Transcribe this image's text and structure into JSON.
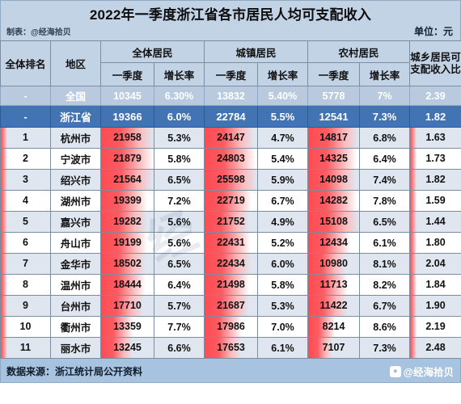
{
  "header": {
    "title": "2022年一季度浙江省各市居民人均可支配收入",
    "credit": "制表：@经海拾贝",
    "unit": "单位：元"
  },
  "columns": {
    "rank": "全体排名",
    "region": "地区",
    "group_all": "全体居民",
    "group_urban": "城镇居民",
    "group_rural": "农村居民",
    "ratio": "城乡居民可支配收入比",
    "sub_quarter": "一季度",
    "sub_growth": "增长率"
  },
  "summary_rows": [
    {
      "rank": "-",
      "region": "全国",
      "all_q": "10345",
      "all_g": "6.30%",
      "urban_q": "13832",
      "urban_g": "5.40%",
      "rural_q": "5778",
      "rural_g": "7%",
      "ratio": "2.39"
    },
    {
      "rank": "-",
      "region": "浙江省",
      "all_q": "19366",
      "all_g": "6.0%",
      "urban_q": "22784",
      "urban_g": "5.5%",
      "rural_q": "12541",
      "rural_g": "7.3%",
      "ratio": "1.82"
    }
  ],
  "rows": [
    {
      "rank": "1",
      "region": "杭州市",
      "all_q": "21958",
      "all_g": "5.3%",
      "urban_q": "24147",
      "urban_g": "4.7%",
      "rural_q": "14817",
      "rural_g": "6.8%",
      "ratio": "1.63"
    },
    {
      "rank": "2",
      "region": "宁波市",
      "all_q": "21879",
      "all_g": "5.8%",
      "urban_q": "24803",
      "urban_g": "5.4%",
      "rural_q": "14325",
      "rural_g": "6.4%",
      "ratio": "1.73"
    },
    {
      "rank": "3",
      "region": "绍兴市",
      "all_q": "21564",
      "all_g": "6.5%",
      "urban_q": "25598",
      "urban_g": "5.9%",
      "rural_q": "14098",
      "rural_g": "7.4%",
      "ratio": "1.82"
    },
    {
      "rank": "4",
      "region": "湖州市",
      "all_q": "19399",
      "all_g": "7.2%",
      "urban_q": "22719",
      "urban_g": "6.7%",
      "rural_q": "14282",
      "rural_g": "7.8%",
      "ratio": "1.59"
    },
    {
      "rank": "5",
      "region": "嘉兴市",
      "all_q": "19282",
      "all_g": "5.6%",
      "urban_q": "21752",
      "urban_g": "4.9%",
      "rural_q": "15108",
      "rural_g": "6.5%",
      "ratio": "1.44"
    },
    {
      "rank": "6",
      "region": "舟山市",
      "all_q": "19199",
      "all_g": "5.6%",
      "urban_q": "22431",
      "urban_g": "5.2%",
      "rural_q": "12434",
      "rural_g": "6.1%",
      "ratio": "1.80"
    },
    {
      "rank": "7",
      "region": "金华市",
      "all_q": "18502",
      "all_g": "6.5%",
      "urban_q": "22434",
      "urban_g": "6.0%",
      "rural_q": "10980",
      "rural_g": "8.1%",
      "ratio": "2.04"
    },
    {
      "rank": "8",
      "region": "温州市",
      "all_q": "18444",
      "all_g": "6.4%",
      "urban_q": "21498",
      "urban_g": "5.8%",
      "rural_q": "11713",
      "rural_g": "8.2%",
      "ratio": "1.84"
    },
    {
      "rank": "9",
      "region": "台州市",
      "all_q": "17710",
      "all_g": "5.7%",
      "urban_q": "21687",
      "urban_g": "5.3%",
      "rural_q": "11422",
      "rural_g": "6.7%",
      "ratio": "1.90"
    },
    {
      "rank": "10",
      "region": "衢州市",
      "all_q": "13359",
      "all_g": "7.7%",
      "urban_q": "17986",
      "urban_g": "7.0%",
      "rural_q": "8214",
      "rural_g": "8.6%",
      "ratio": "2.19"
    },
    {
      "rank": "11",
      "region": "丽水市",
      "all_q": "13245",
      "all_g": "6.6%",
      "urban_q": "17653",
      "urban_g": "6.1%",
      "rural_q": "7107",
      "rural_g": "7.3%",
      "ratio": "2.48"
    }
  ],
  "footer": {
    "source": "数据来源：浙江统计局公开资料",
    "brand": "@经海拾贝"
  },
  "watermark": "经",
  "colors": {
    "band": "#c3d3e6",
    "province_row": "#4274b4",
    "national_row": "#b9cadf",
    "bar": "#ff4b52",
    "footer": "#a8c3e0",
    "odd_row": "#dfe6ef",
    "even_row": "#ffffff"
  },
  "chart_data": {
    "type": "table",
    "title": "2022年一季度浙江省各市居民人均可支配收入",
    "unit": "元",
    "categories": [
      "杭州市",
      "宁波市",
      "绍兴市",
      "湖州市",
      "嘉兴市",
      "舟山市",
      "金华市",
      "温州市",
      "台州市",
      "衢州市",
      "丽水市"
    ],
    "series": [
      {
        "name": "全体居民一季度",
        "values": [
          21958,
          21879,
          21564,
          19399,
          19282,
          19199,
          18502,
          18444,
          17710,
          13359,
          13245
        ]
      },
      {
        "name": "全体居民增长率",
        "values": [
          5.3,
          5.8,
          6.5,
          7.2,
          5.6,
          5.6,
          6.5,
          6.4,
          5.7,
          7.7,
          6.6
        ]
      },
      {
        "name": "城镇居民一季度",
        "values": [
          24147,
          24803,
          25598,
          22719,
          21752,
          22431,
          22434,
          21498,
          21687,
          17986,
          17653
        ]
      },
      {
        "name": "城镇居民增长率",
        "values": [
          4.7,
          5.4,
          5.9,
          6.7,
          4.9,
          5.2,
          6.0,
          5.8,
          5.3,
          7.0,
          6.1
        ]
      },
      {
        "name": "农村居民一季度",
        "values": [
          14817,
          14325,
          14098,
          14282,
          15108,
          12434,
          10980,
          11713,
          11422,
          8214,
          7107
        ]
      },
      {
        "name": "农村居民增长率",
        "values": [
          6.8,
          6.4,
          7.4,
          7.8,
          6.5,
          6.1,
          8.1,
          8.2,
          6.7,
          8.6,
          7.3
        ]
      },
      {
        "name": "城乡居民可支配收入比",
        "values": [
          1.63,
          1.73,
          1.82,
          1.59,
          1.44,
          1.8,
          2.04,
          1.84,
          1.9,
          2.19,
          2.48
        ]
      }
    ],
    "reference_rows": [
      {
        "name": "全国",
        "values": [
          10345,
          6.3,
          13832,
          5.4,
          5778,
          7.0,
          2.39
        ]
      },
      {
        "name": "浙江省",
        "values": [
          19366,
          6.0,
          22784,
          5.5,
          12541,
          7.3,
          1.82
        ]
      }
    ]
  }
}
